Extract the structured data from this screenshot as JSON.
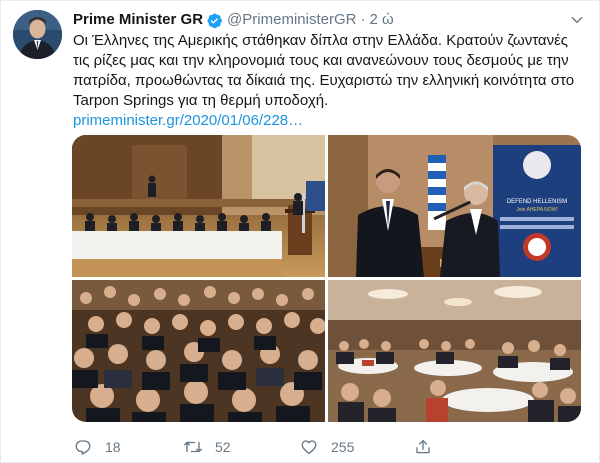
{
  "tweet": {
    "author_name": "Prime Minister GR",
    "handle": "@PrimeministerGR",
    "separator": "·",
    "time": "2 ώ",
    "text": "Οι Έλληνες της Αμερικής στάθηκαν δίπλα στην Ελλάδα. Κρατούν ζωντανές τις ρίζες μας και την κληρονομιά τους και ανανεώνουν τους δεσμούς με την πατρίδα, προωθώντας τα δίκαιά της. Ευχαριστώ την ελληνική κοινότητα στο Tarpon Springs για τη θερμή υποδοχή.",
    "link": "primeminister.gr/2020/01/06/228…",
    "photo_banner_title": "DEFEND HELLENISM",
    "photo_banner_sub": "Join AHEPA NOW!"
  },
  "actions": {
    "replies": "18",
    "retweets": "52",
    "likes": "255"
  },
  "colors": {
    "link": "#1b95e0",
    "secondary": "#657786",
    "verified": "#1da1f2"
  },
  "icons": [
    "verified-badge-icon",
    "caret-down-icon",
    "reply-icon",
    "retweet-icon",
    "like-icon",
    "share-icon"
  ]
}
